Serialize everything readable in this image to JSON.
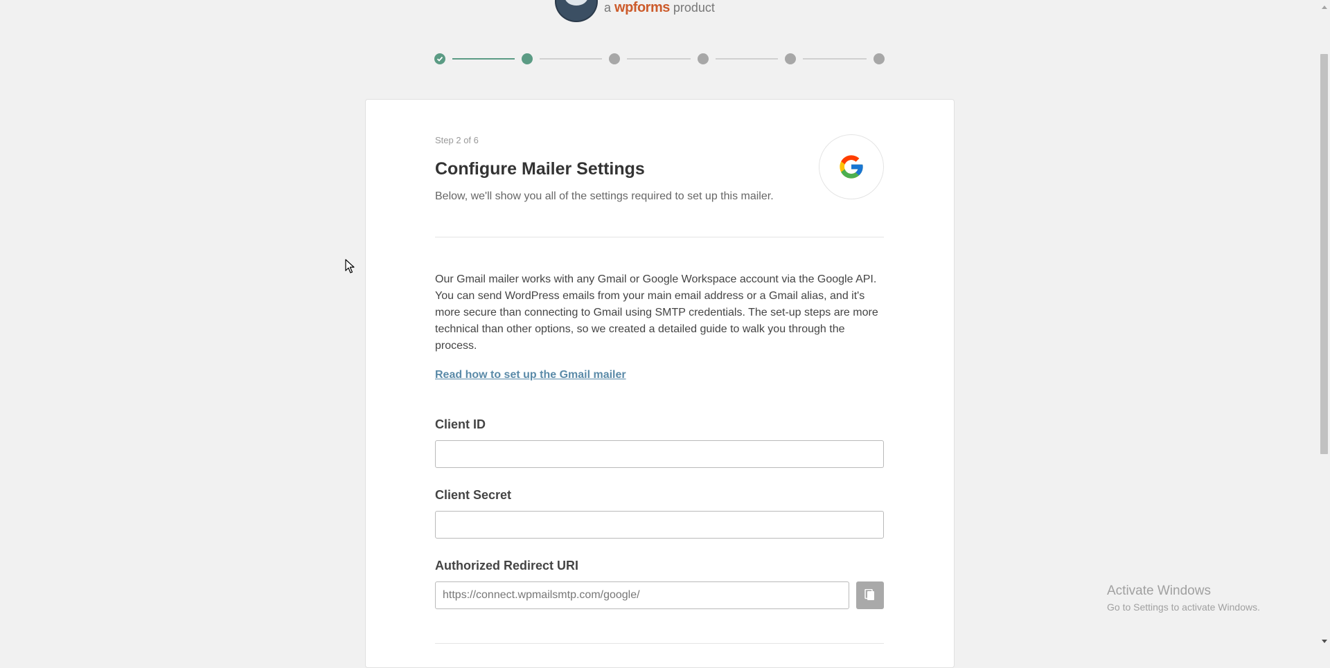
{
  "brand": {
    "prefix": "a",
    "name": "wpforms",
    "suffix": "product"
  },
  "steps": {
    "total": 6,
    "current": 2,
    "completed": 1
  },
  "card": {
    "step_label": "Step 2 of 6",
    "title": "Configure Mailer Settings",
    "subtitle": "Below, we'll show you all of the settings required to set up this mailer.",
    "mailer_icon": "google-icon",
    "description": "Our Gmail mailer works with any Gmail or Google Workspace account via the Google API. You can send WordPress emails from your main email address or a Gmail alias, and it's more secure than connecting to Gmail using SMTP credentials. The set-up steps are more technical than other options, so we created a detailed guide to walk you through the process.",
    "guide_link": "Read how to set up the Gmail mailer"
  },
  "fields": {
    "client_id_label": "Client ID",
    "client_id_value": "",
    "client_secret_label": "Client Secret",
    "client_secret_value": "",
    "redirect_uri_label": "Authorized Redirect URI",
    "redirect_uri_value": "https://connect.wpmailsmtp.com/google/",
    "copy_icon": "copy-icon"
  },
  "watermark": {
    "title": "Activate Windows",
    "subtitle": "Go to Settings to activate Windows."
  },
  "colors": {
    "accent": "#5b9b84",
    "link": "#5a8aa8",
    "brand_orange": "#cc5b2b"
  }
}
